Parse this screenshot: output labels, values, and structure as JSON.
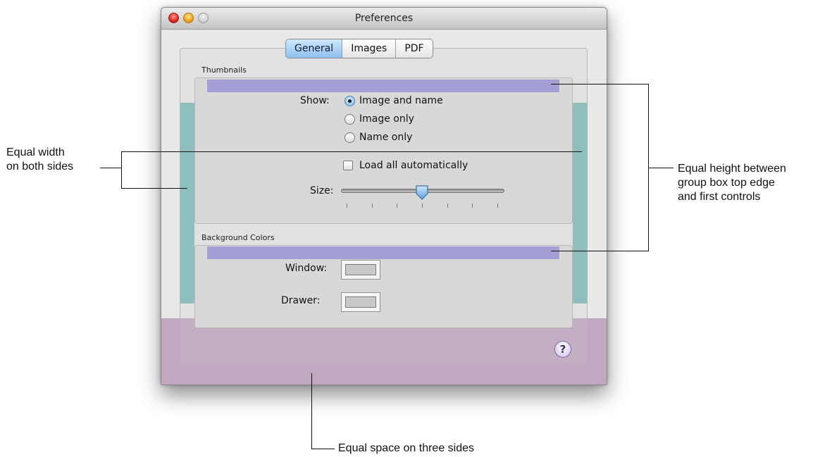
{
  "window": {
    "title": "Preferences"
  },
  "tabs": [
    {
      "label": "General",
      "selected": true
    },
    {
      "label": "Images",
      "selected": false
    },
    {
      "label": "PDF",
      "selected": false
    }
  ],
  "thumbnails": {
    "group_label": "Thumbnails",
    "show_label": "Show:",
    "options": [
      {
        "label": "Image and name",
        "selected": true
      },
      {
        "label": "Image only",
        "selected": false
      },
      {
        "label": "Name only",
        "selected": false
      }
    ],
    "load_all_label": "Load all automatically",
    "load_all_checked": false,
    "size_label": "Size:",
    "size_fraction": 0.5,
    "tick_count": 7
  },
  "background_colors": {
    "group_label": "Background Colors",
    "window_label": "Window:",
    "drawer_label": "Drawer:"
  },
  "help": {
    "glyph": "?"
  },
  "annotations": {
    "left_line1": "Equal width",
    "left_line2": "on both sides",
    "right_line1": "Equal height between",
    "right_line2": "group box top edge",
    "right_line3": "and first controls",
    "bottom": "Equal space on three sides"
  },
  "colors": {
    "teal_overlay": "#8ebfbd",
    "purple_overlay": "#a49fd4",
    "mauve_overlay": "#c1a8c0",
    "selected_tab": "#8dc0ef"
  }
}
